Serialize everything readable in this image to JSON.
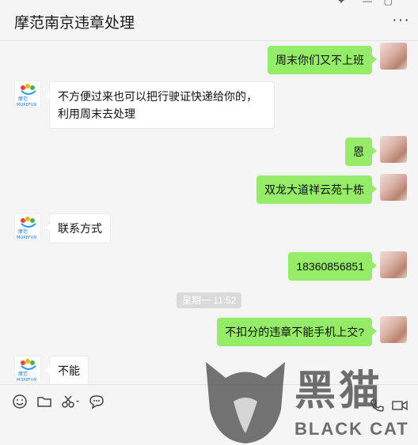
{
  "header": {
    "title": "摩范南京违章处理",
    "more_label": "···"
  },
  "messages": [
    {
      "side": "self",
      "text": "周末你们又不上班"
    },
    {
      "side": "other",
      "text": "不方便过来也可以把行驶证快递给你的，利用周末去处理"
    },
    {
      "side": "self",
      "text": "恩"
    },
    {
      "side": "self",
      "text": "双龙大道祥云苑十栋"
    },
    {
      "side": "other",
      "text": "联系方式"
    },
    {
      "side": "self",
      "text": "18360856851"
    },
    {
      "side": "self",
      "text": "不扣分的违章不能手机上交?"
    },
    {
      "side": "other",
      "text": "不能"
    }
  ],
  "time_separator": "星期一 11:52",
  "avatar_other_text": {
    "top": "摩范",
    "bottom": "MOREFUN"
  },
  "watermark": {
    "cn": "黑猫",
    "en": "BLACK CAT"
  },
  "colors": {
    "self_bubble": "#95ec69",
    "other_bubble": "#ffffff",
    "background": "#f5f5f5"
  },
  "toolbar": {
    "icons": [
      "emoji-icon",
      "folder-icon",
      "scissors-icon",
      "chat-history-icon",
      "phone-icon",
      "video-icon"
    ]
  }
}
